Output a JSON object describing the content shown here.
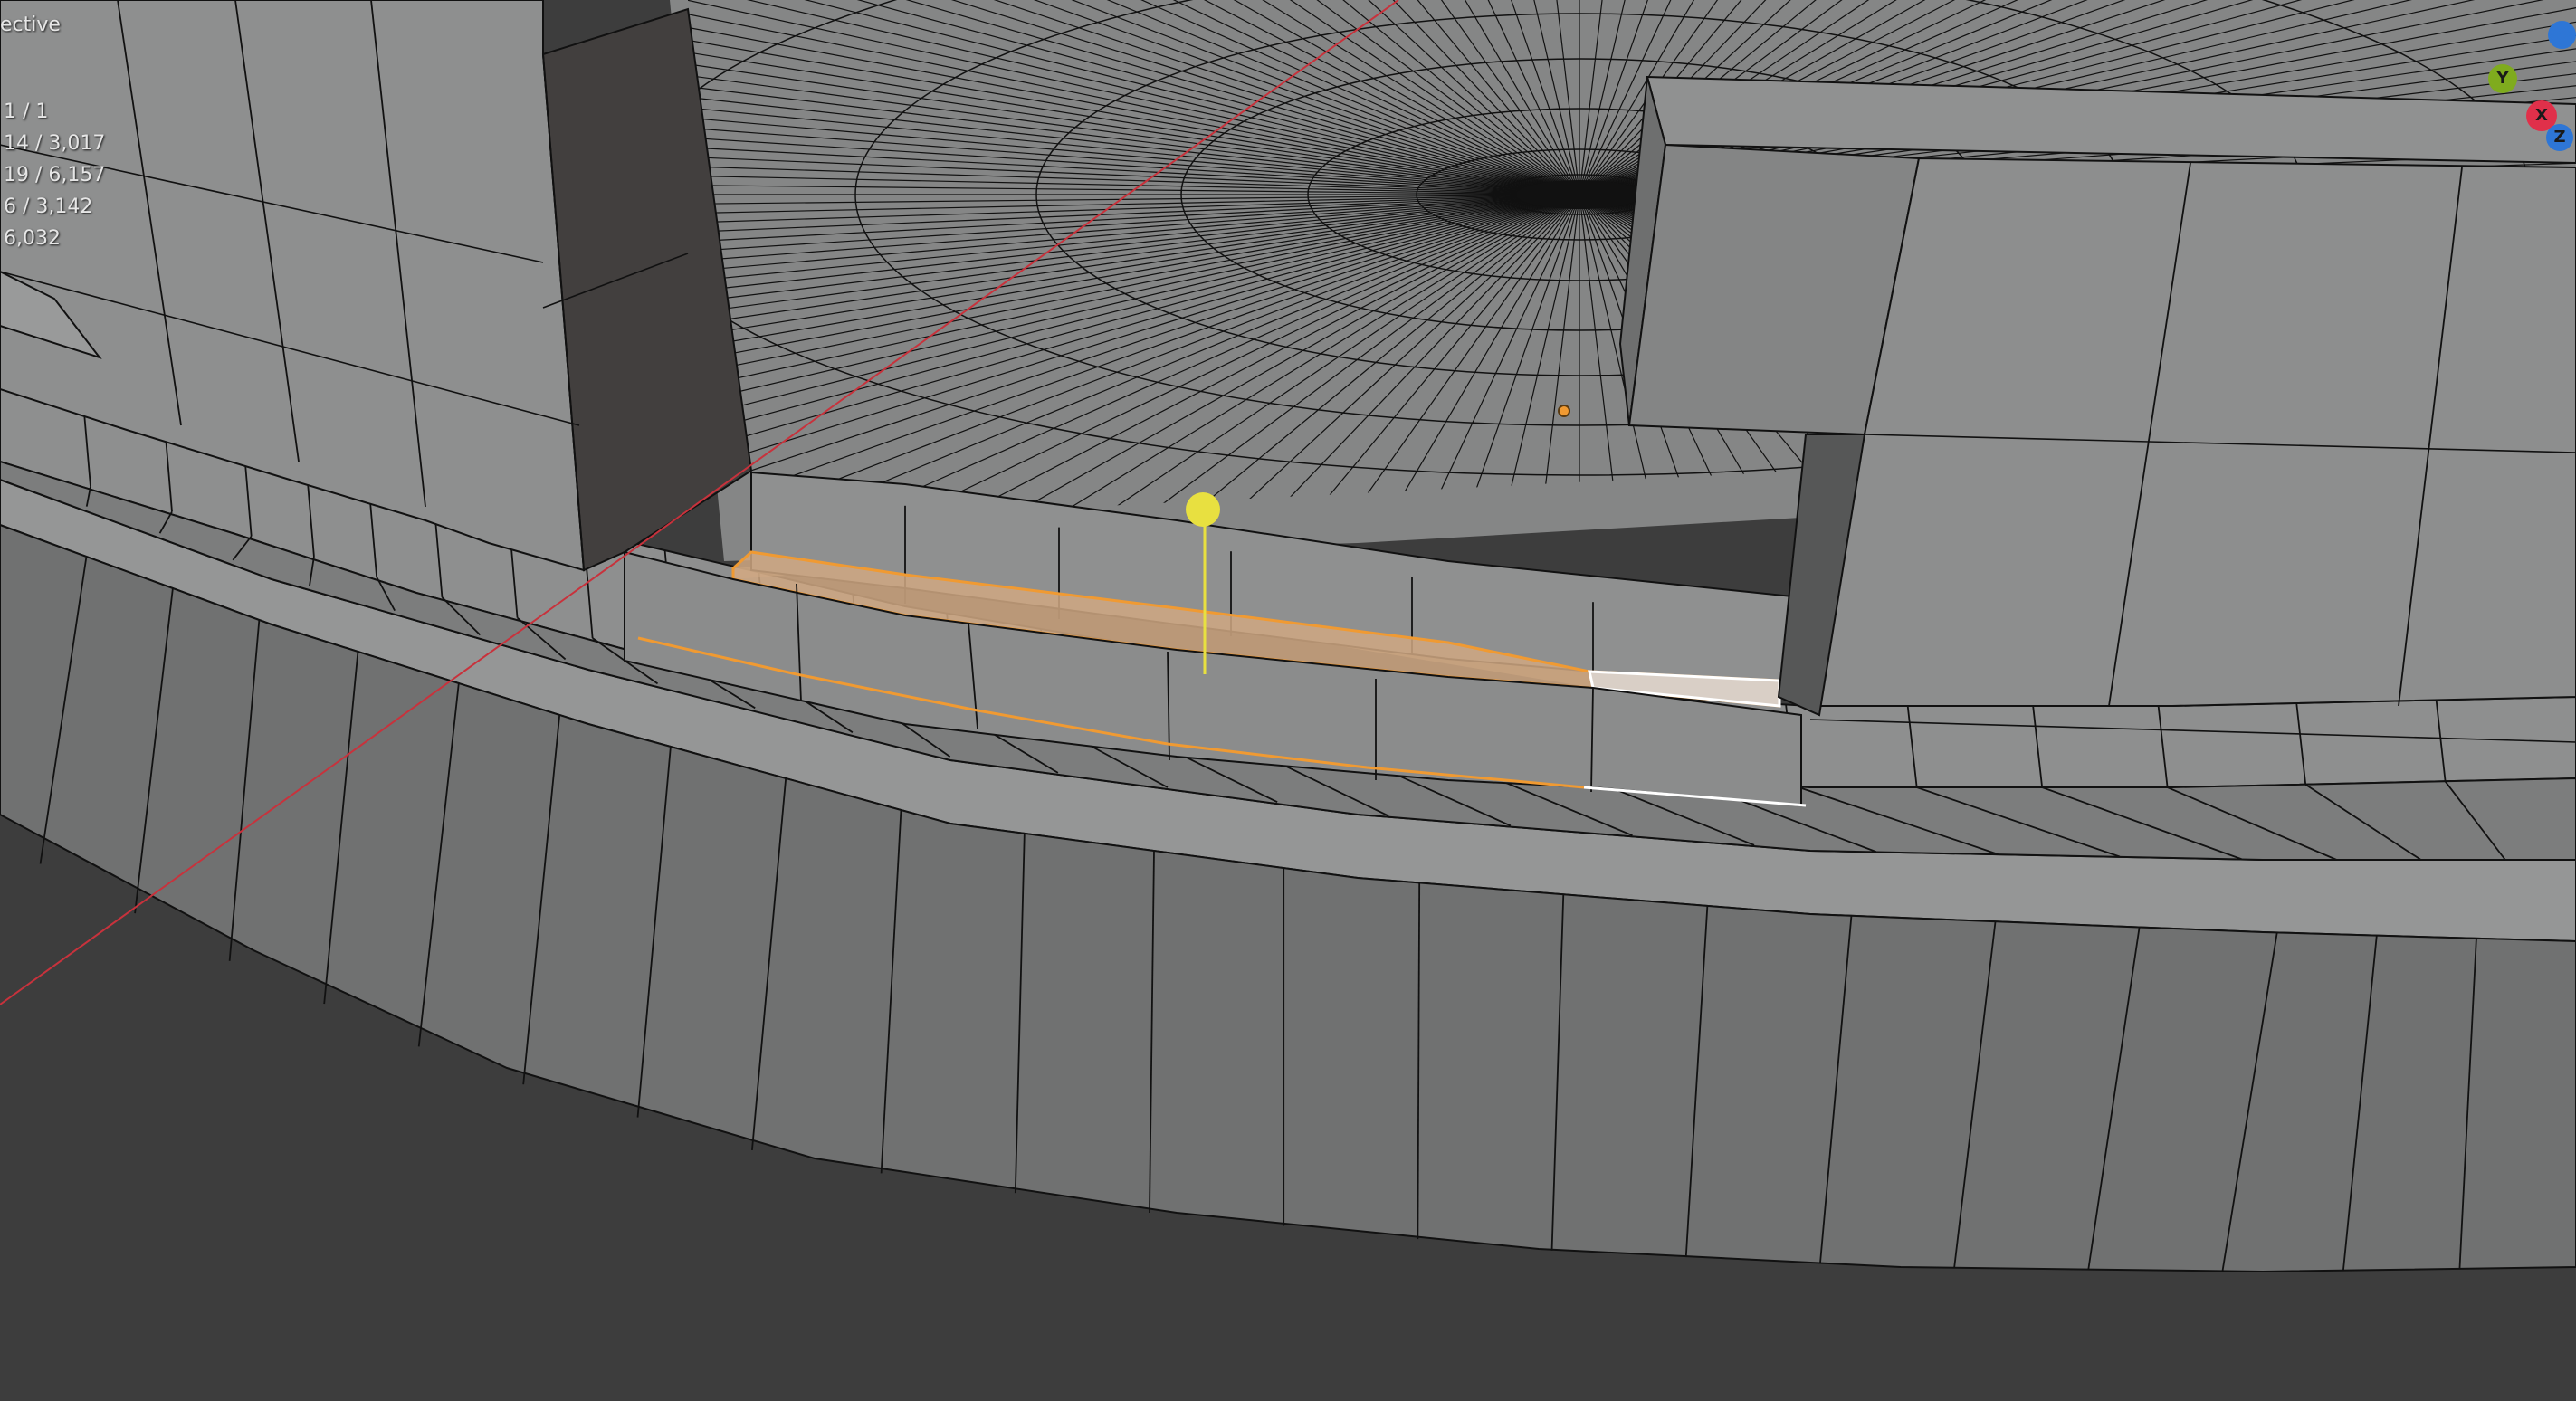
{
  "viewport": {
    "view_mode": "ective",
    "stats": [
      "1 / 1",
      "14 / 3,017",
      "19 / 6,157",
      "6 / 3,142",
      "6,032"
    ]
  },
  "gizmo": {
    "y_label": "Y",
    "x_label": "X",
    "z_label": "Z",
    "colors": {
      "x": "#e0304a",
      "y": "#7fab1e",
      "z": "#2e76d6"
    }
  },
  "colors": {
    "background": "#3d3d3d",
    "face": "#8c8d8d",
    "face_dark": "#6c6d6d",
    "face_shadow": "#414040",
    "wire": "#111111",
    "selection": "#f09a32",
    "active": "#ffffff",
    "x_axis_line": "#c8323c",
    "gizmo_handle": "#e8e040"
  },
  "icons": {
    "transform_handle": "yellow-sphere-handle-icon",
    "object_origin": "orange-dot-icon"
  }
}
